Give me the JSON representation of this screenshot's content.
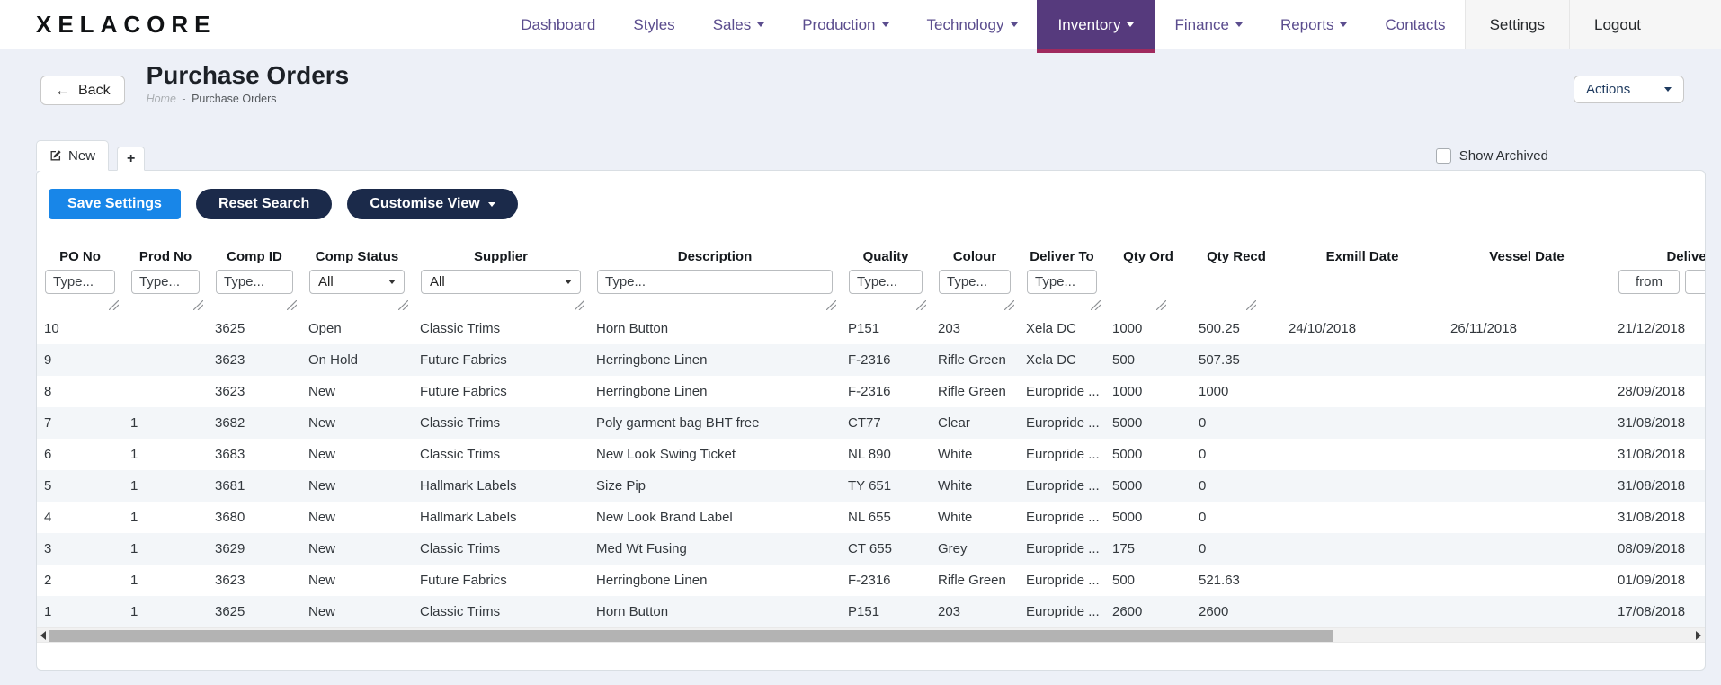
{
  "brand": {
    "logo": "XELACORE"
  },
  "nav": {
    "items": [
      {
        "label": "Dashboard",
        "caret": false,
        "active": false
      },
      {
        "label": "Styles",
        "caret": false,
        "active": false
      },
      {
        "label": "Sales",
        "caret": true,
        "active": false
      },
      {
        "label": "Production",
        "caret": true,
        "active": false
      },
      {
        "label": "Technology",
        "caret": true,
        "active": false
      },
      {
        "label": "Inventory",
        "caret": true,
        "active": true
      },
      {
        "label": "Finance",
        "caret": true,
        "active": false
      },
      {
        "label": "Reports",
        "caret": true,
        "active": false
      },
      {
        "label": "Contacts",
        "caret": false,
        "active": false
      }
    ],
    "right": [
      {
        "label": "Settings"
      },
      {
        "label": "Logout"
      }
    ]
  },
  "header": {
    "back_label": "Back",
    "title": "Purchase Orders",
    "breadcrumb": {
      "home": "Home",
      "separator": "-",
      "current": "Purchase Orders"
    },
    "actions_label": "Actions"
  },
  "tabs": {
    "active_tab_label": "New",
    "add_tab_label": "+",
    "show_archived_label": "Show Archived",
    "show_archived_checked": false
  },
  "toolbar": {
    "save_label": "Save Settings",
    "reset_label": "Reset Search",
    "customise_label": "Customise View"
  },
  "table": {
    "columns": [
      {
        "label": "PO No",
        "sortable": false,
        "filter": "text",
        "placeholder": "Type..."
      },
      {
        "label": "Prod No",
        "sortable": true,
        "filter": "text",
        "placeholder": "Type..."
      },
      {
        "label": "Comp ID",
        "sortable": true,
        "filter": "text",
        "placeholder": "Type..."
      },
      {
        "label": "Comp Status",
        "sortable": true,
        "filter": "select",
        "value": "All"
      },
      {
        "label": "Supplier",
        "sortable": true,
        "filter": "select",
        "value": "All"
      },
      {
        "label": "Description",
        "sortable": false,
        "filter": "text",
        "placeholder": "Type..."
      },
      {
        "label": "Quality",
        "sortable": true,
        "filter": "text",
        "placeholder": "Type..."
      },
      {
        "label": "Colour",
        "sortable": true,
        "filter": "text",
        "placeholder": "Type..."
      },
      {
        "label": "Deliver To",
        "sortable": true,
        "filter": "text",
        "placeholder": "Type..."
      },
      {
        "label": "Qty Ord",
        "sortable": true,
        "filter": "none"
      },
      {
        "label": "Qty Recd",
        "sortable": true,
        "filter": "none"
      },
      {
        "label": "Exmill Date",
        "sortable": true,
        "filter": "none"
      },
      {
        "label": "Vessel Date",
        "sortable": true,
        "filter": "none"
      },
      {
        "label": "Delivery Date",
        "sortable": true,
        "filter": "range",
        "placeholder_from": "from"
      }
    ],
    "rows": [
      [
        "10",
        "",
        "3625",
        "Open",
        "Classic Trims",
        "Horn Button",
        "P151",
        "203",
        "Xela DC",
        "1000",
        "500.25",
        "24/10/2018",
        "26/11/2018",
        "21/12/2018"
      ],
      [
        "9",
        "",
        "3623",
        "On Hold",
        "Future Fabrics",
        "Herringbone Linen",
        "F-2316",
        "Rifle Green",
        "Xela DC",
        "500",
        "507.35",
        "",
        "",
        ""
      ],
      [
        "8",
        "",
        "3623",
        "New",
        "Future Fabrics",
        "Herringbone Linen",
        "F-2316",
        "Rifle Green",
        "Europride ...",
        "1000",
        "1000",
        "",
        "",
        "28/09/2018"
      ],
      [
        "7",
        "1",
        "3682",
        "New",
        "Classic Trims",
        "Poly garment bag BHT free",
        "CT77",
        "Clear",
        "Europride ...",
        "5000",
        "0",
        "",
        "",
        "31/08/2018"
      ],
      [
        "6",
        "1",
        "3683",
        "New",
        "Classic Trims",
        "New Look Swing Ticket",
        "NL 890",
        "White",
        "Europride ...",
        "5000",
        "0",
        "",
        "",
        "31/08/2018"
      ],
      [
        "5",
        "1",
        "3681",
        "New",
        "Hallmark Labels",
        "Size Pip",
        "TY 651",
        "White",
        "Europride ...",
        "5000",
        "0",
        "",
        "",
        "31/08/2018"
      ],
      [
        "4",
        "1",
        "3680",
        "New",
        "Hallmark Labels",
        "New Look Brand Label",
        "NL 655",
        "White",
        "Europride ...",
        "5000",
        "0",
        "",
        "",
        "31/08/2018"
      ],
      [
        "3",
        "1",
        "3629",
        "New",
        "Classic Trims",
        "Med Wt Fusing",
        "CT 655",
        "Grey",
        "Europride ...",
        "175",
        "0",
        "",
        "",
        "08/09/2018"
      ],
      [
        "2",
        "1",
        "3623",
        "New",
        "Future Fabrics",
        "Herringbone Linen",
        "F-2316",
        "Rifle Green",
        "Europride ...",
        "500",
        "521.63",
        "",
        "",
        "01/09/2018"
      ],
      [
        "1",
        "1",
        "3625",
        "New",
        "Classic Trims",
        "Horn Button",
        "P151",
        "203",
        "Europride ...",
        "2600",
        "2600",
        "",
        "",
        "17/08/2018"
      ]
    ]
  },
  "colors": {
    "nav_link": "#5b4d8e",
    "nav_active_bg": "#563a7d",
    "nav_active_accent": "#a02a5e",
    "primary_button": "#1886e8",
    "dark_button": "#1b2a4a",
    "link_navy": "#1e3a5f",
    "row_stripe": "#f3f6f9",
    "page_background": "#edf0f7"
  }
}
